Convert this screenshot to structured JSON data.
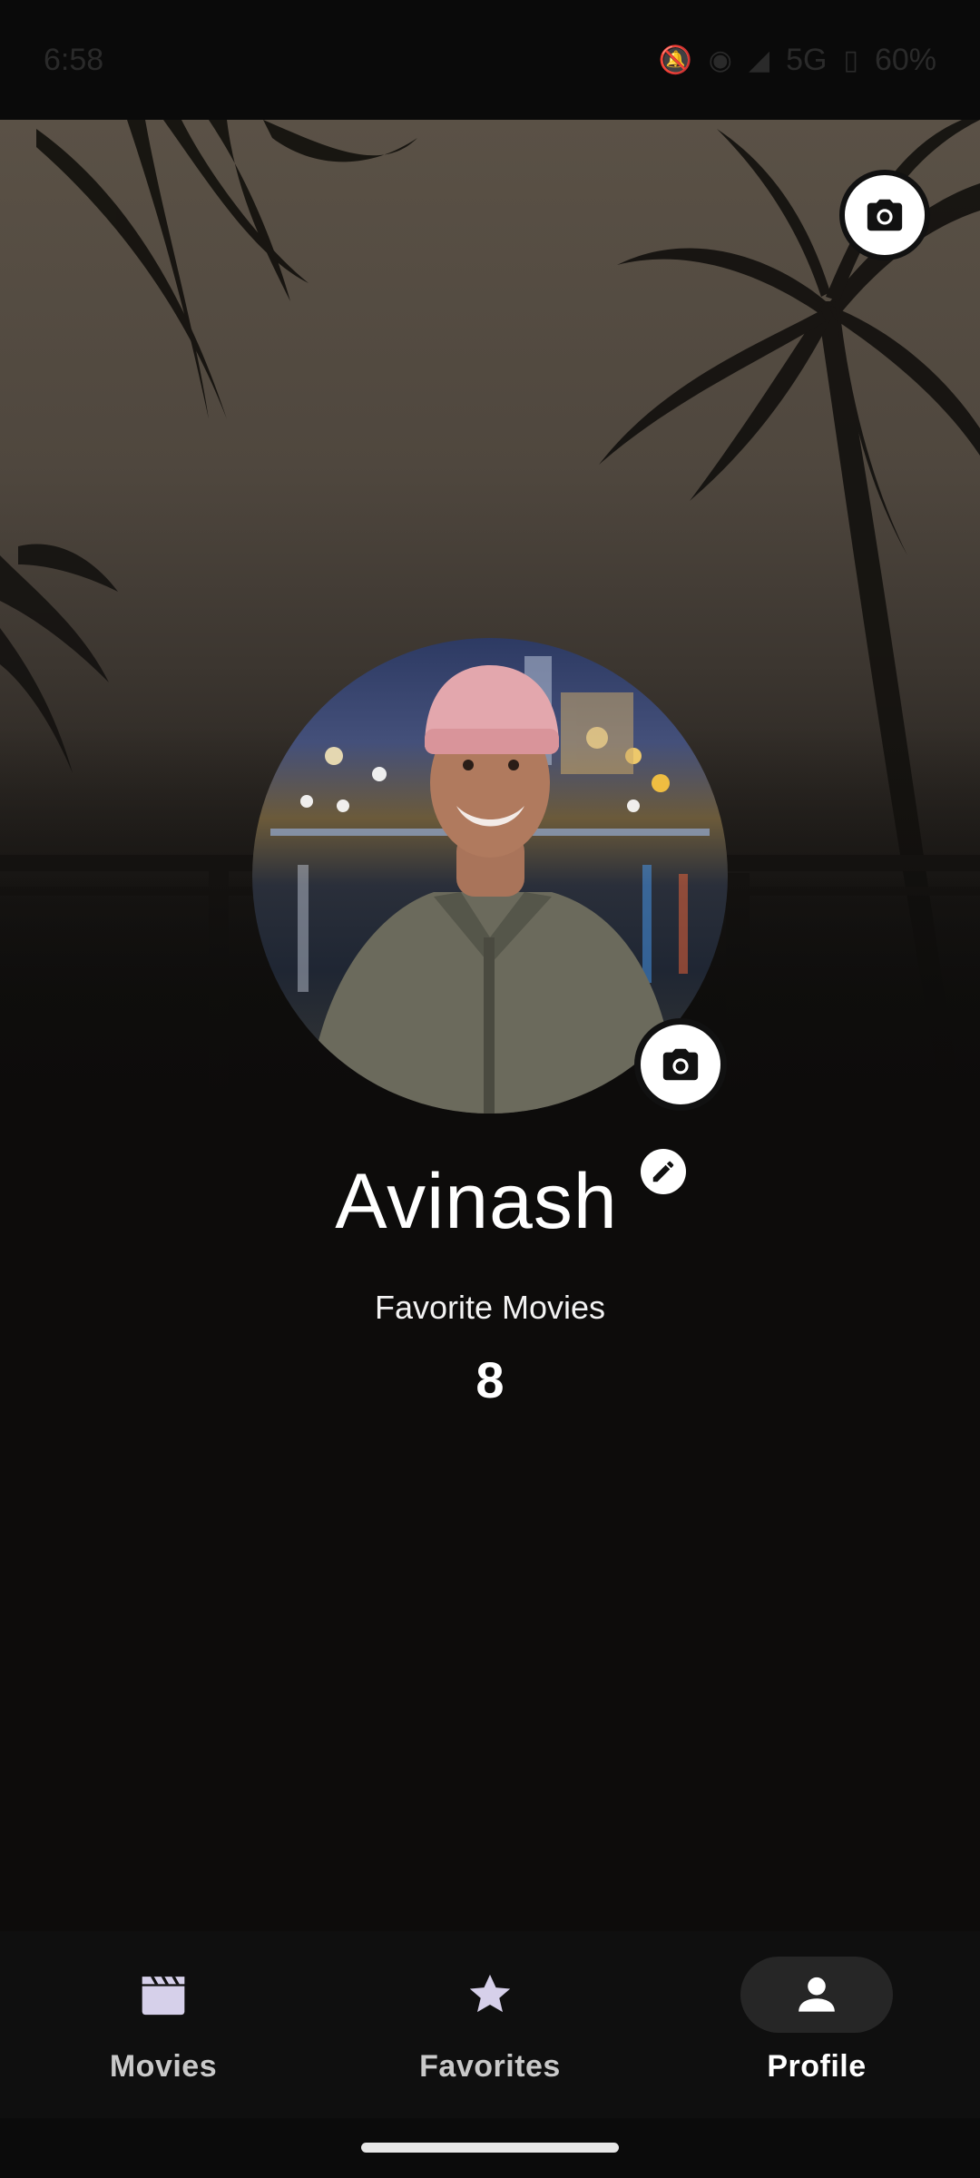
{
  "status_bar": {
    "time": "6:58",
    "network": "5G",
    "battery": "60%",
    "icons": [
      "bell-off-icon",
      "hotspot-icon",
      "signal-icon",
      "battery-icon"
    ]
  },
  "profile": {
    "name": "Avinash",
    "stat_label": "Favorite Movies",
    "stat_value": "8"
  },
  "actions": {
    "cover_camera_icon": "camera-icon",
    "avatar_camera_icon": "camera-icon",
    "edit_icon": "pencil-icon"
  },
  "nav": {
    "items": [
      {
        "label": "Movies",
        "icon": "clapperboard-icon",
        "active": false
      },
      {
        "label": "Favorites",
        "icon": "star-icon",
        "active": false
      },
      {
        "label": "Profile",
        "icon": "person-icon",
        "active": true
      }
    ]
  },
  "colors": {
    "background": "#0d0c0b",
    "active_pill": "#262626",
    "nav_bar": "#0f0f0f"
  }
}
